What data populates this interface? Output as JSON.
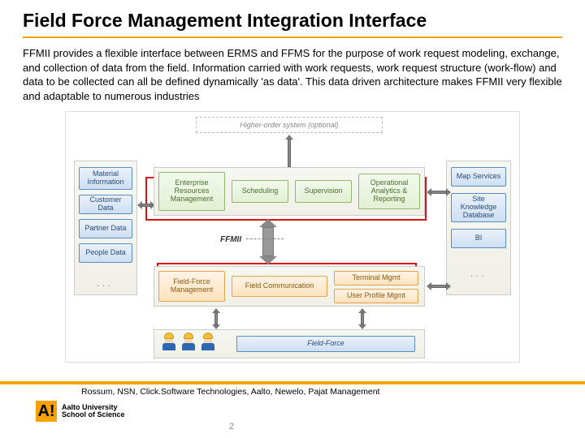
{
  "title": "Field Force Management Integration Interface",
  "body": "FFMII provides a flexible interface between ERMS and FFMS for the purpose of work request modeling, exchange, and collection of data from the field. Information carried with work requests, work request structure (work-flow)  and data to be collected can all be defined dynamically 'as data'. This data driven architecture makes FFMII very flexible and adaptable to numerous industries",
  "diagram": {
    "higher": "Higher-order system (optional)",
    "left": [
      "Material Information",
      "Customer Data",
      "Partner Data",
      "People Data"
    ],
    "erm": "Enterprise Resources Management",
    "erm_sub": [
      "Scheduling",
      "Supervision",
      "Operational Analytics & Reporting"
    ],
    "ffmii": "FFMII",
    "ffm": "Field-Force Management",
    "ffm_sub": [
      "Field Communication",
      "Terminal Mgmt",
      "User Profile Mgmt"
    ],
    "right": [
      "Map Services",
      "Site Knowledge Database",
      "BI"
    ],
    "field_force": "Field-Force",
    "dots": ". . ."
  },
  "credits": "Rossum, NSN, Click.Software Technologies, Aalto, Newelo, Pajat Management",
  "logo": {
    "mark": "A!",
    "line1": "Aalto University",
    "line2": "School of Science"
  },
  "page": "2"
}
